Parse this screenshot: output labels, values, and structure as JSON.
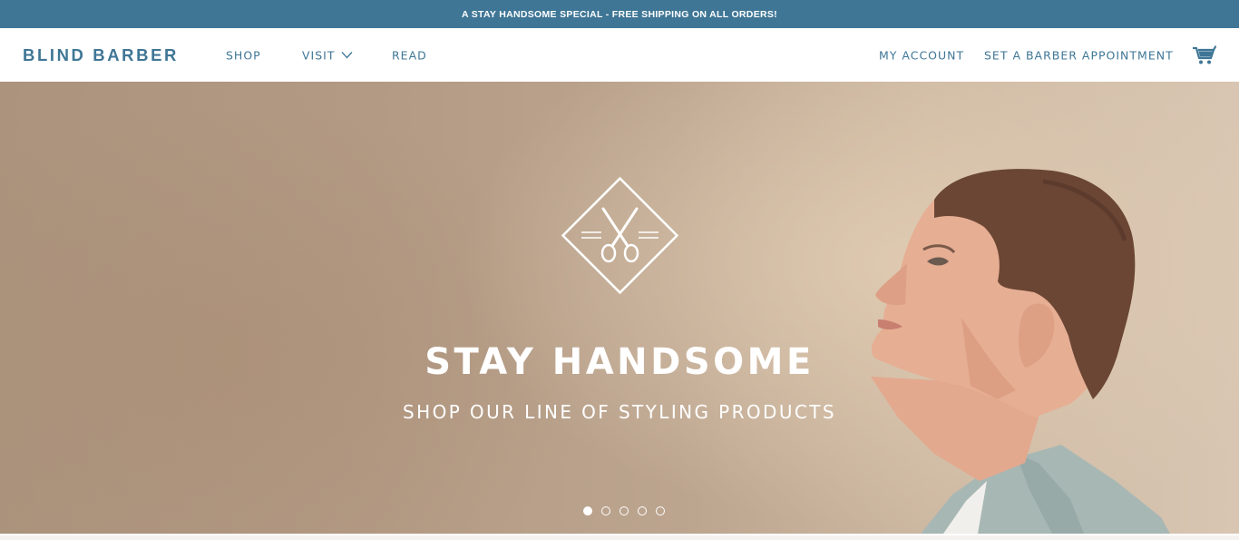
{
  "promo": {
    "text": "A STAY HANDSOME SPECIAL - FREE SHIPPING ON ALL ORDERS!"
  },
  "nav": {
    "logo": "BLIND BARBER",
    "shop": "SHOP",
    "visit": "VISIT",
    "read": "READ",
    "account": "MY ACCOUNT",
    "appointment": "SET A BARBER APPOINTMENT",
    "cart_icon": "cart-icon",
    "visit_icon": "chevron-down-icon"
  },
  "hero": {
    "title": "STAY HANDSOME",
    "subtitle": "SHOP OUR LINE OF STYLING PRODUCTS",
    "emblem_icon": "scissors-diamond-emblem",
    "slides": [
      {
        "active": true
      },
      {
        "active": false
      },
      {
        "active": false
      },
      {
        "active": false
      },
      {
        "active": false
      }
    ]
  },
  "colors": {
    "brand": "#3f7696",
    "promo_bg": "#3f7696",
    "hero_bg": "#b8a08a",
    "text_light": "#ffffff"
  }
}
